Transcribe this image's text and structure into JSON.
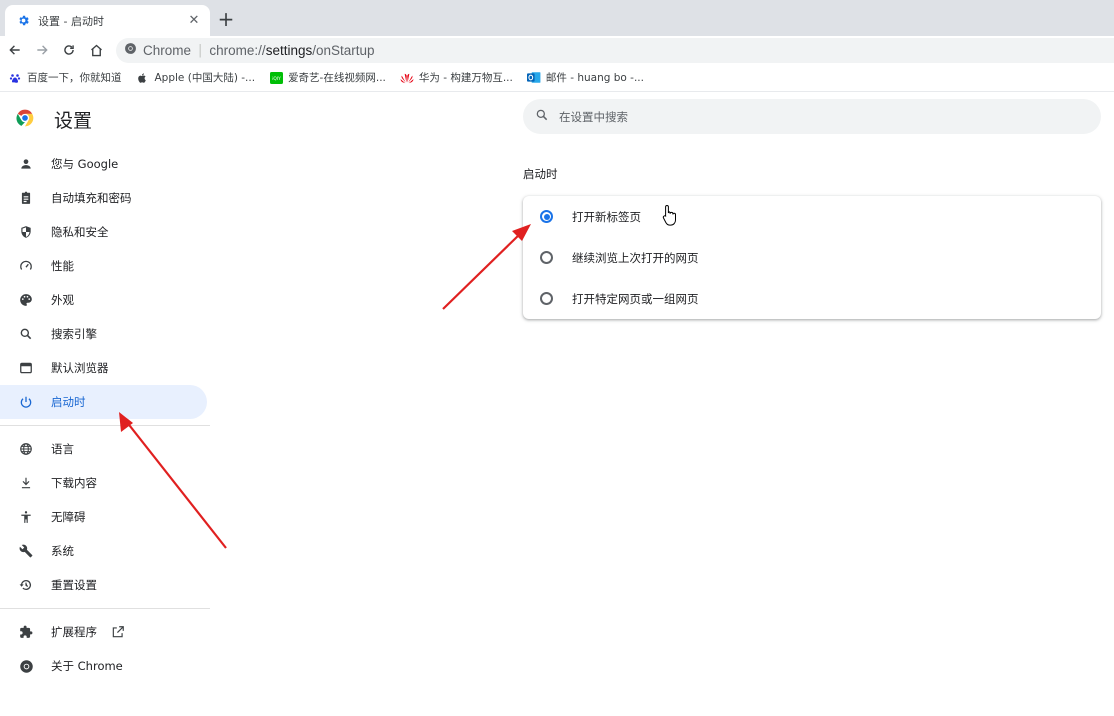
{
  "browser": {
    "tab": {
      "title": "设置 - 启动时",
      "favicon": "gear-icon",
      "close": "✕"
    },
    "new_tab": "+",
    "omnibox": {
      "site": "Chrome",
      "url_prefix": "chrome://",
      "url_host": "settings",
      "url_path": "/onStartup"
    },
    "bookmarks": [
      {
        "label": "百度一下，你就知道",
        "icon": "paw-icon"
      },
      {
        "label": "Apple (中国大陆) -...",
        "icon": "apple-icon"
      },
      {
        "label": "爱奇艺-在线视频网...",
        "icon": "iqiyi-icon"
      },
      {
        "label": "华为 - 构建万物互...",
        "icon": "huawei-icon"
      },
      {
        "label": "邮件 - huang bo -...",
        "icon": "outlook-icon"
      }
    ]
  },
  "settings": {
    "title": "设置",
    "search_placeholder": "在设置中搜索",
    "nav": [
      {
        "label": "您与 Google",
        "icon": "person-icon"
      },
      {
        "label": "自动填充和密码",
        "icon": "clipboard-icon"
      },
      {
        "label": "隐私和安全",
        "icon": "shield-icon"
      },
      {
        "label": "性能",
        "icon": "speedometer-icon"
      },
      {
        "label": "外观",
        "icon": "palette-icon"
      },
      {
        "label": "搜索引擎",
        "icon": "search-icon"
      },
      {
        "label": "默认浏览器",
        "icon": "browser-window-icon"
      },
      {
        "label": "启动时",
        "icon": "power-icon",
        "active": true
      },
      {
        "label": "语言",
        "icon": "globe-icon"
      },
      {
        "label": "下载内容",
        "icon": "download-icon"
      },
      {
        "label": "无障碍",
        "icon": "accessibility-icon"
      },
      {
        "label": "系统",
        "icon": "wrench-icon"
      },
      {
        "label": "重置设置",
        "icon": "restore-icon"
      },
      {
        "label": "扩展程序",
        "icon": "puzzle-icon"
      },
      {
        "label": "关于 Chrome",
        "icon": "chrome-icon"
      }
    ],
    "startup": {
      "section_title": "启动时",
      "options": [
        {
          "label": "打开新标签页",
          "checked": true
        },
        {
          "label": "继续浏览上次打开的网页",
          "checked": false
        },
        {
          "label": "打开特定网页或一组网页",
          "checked": false
        }
      ]
    }
  },
  "colors": {
    "accent": "#1a73e8",
    "active_nav_bg": "#e8f0fe",
    "arrow": "#e02020"
  }
}
